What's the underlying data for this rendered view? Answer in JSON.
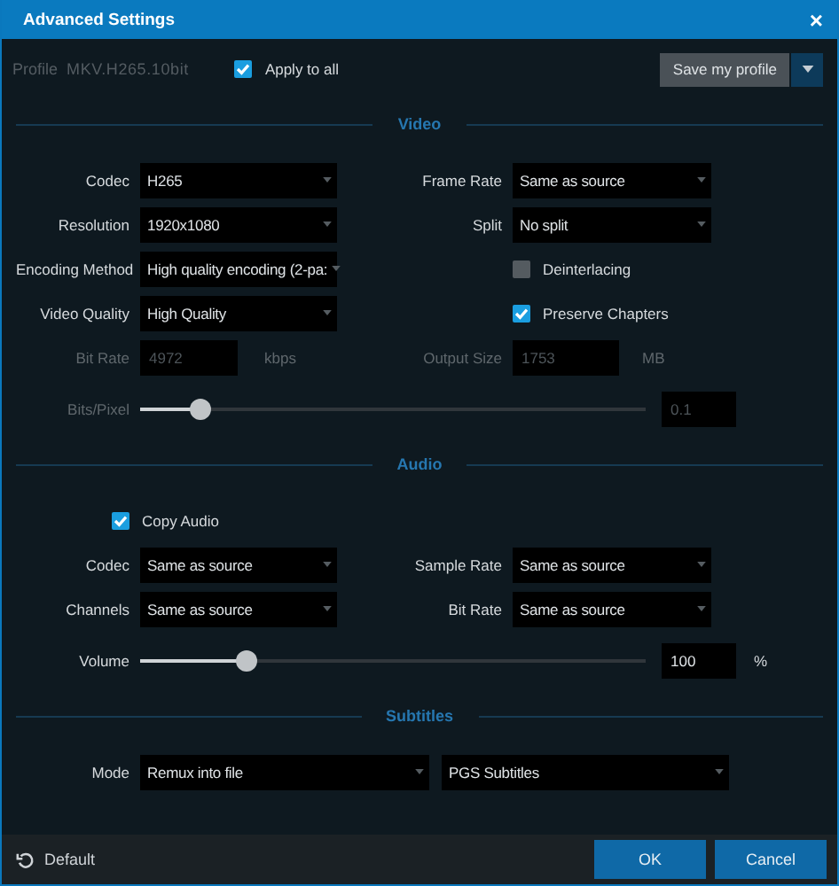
{
  "window": {
    "title": "Advanced Settings",
    "close": "×"
  },
  "profile": {
    "label": "Profile",
    "value": "MKV.H265.10bit"
  },
  "apply_to_all": {
    "label": "Apply to all",
    "checked": true
  },
  "save_profile": {
    "label": "Save my profile"
  },
  "sections": [
    {
      "title": "Video",
      "rows": [
        {
          "kind": "pair",
          "left": {
            "kind": "select",
            "label": "Codec",
            "value": "H265"
          },
          "right": {
            "kind": "select",
            "label": "Frame Rate",
            "value": "Same as source"
          }
        },
        {
          "kind": "pair",
          "left": {
            "kind": "select",
            "label": "Resolution",
            "value": "1920x1080"
          },
          "right": {
            "kind": "select",
            "label": "Split",
            "value": "No split"
          }
        },
        {
          "kind": "pair",
          "left": {
            "kind": "select",
            "label": "Encoding Method",
            "value": "High quality encoding (2-pa:"
          },
          "right": {
            "kind": "checkbox",
            "label": "Deinterlacing",
            "checked": false
          }
        },
        {
          "kind": "pair",
          "left": {
            "kind": "select",
            "label": "Video Quality",
            "value": "High Quality"
          },
          "right": {
            "kind": "checkbox",
            "label": "Preserve Chapters",
            "checked": true
          }
        },
        {
          "kind": "pair",
          "left": {
            "kind": "input",
            "label": "Bit Rate",
            "value": "4972",
            "unit": "kbps",
            "disabled": true
          },
          "right": {
            "kind": "input",
            "label": "Output Size",
            "value": "1753",
            "unit": "MB",
            "disabled": true
          }
        },
        {
          "kind": "slider",
          "label": "Bits/Pixel",
          "level": 0.12,
          "value": "0.1",
          "disabled": true
        }
      ]
    },
    {
      "title": "Audio",
      "rows": [
        {
          "kind": "pair",
          "left": {
            "kind": "checkbox",
            "label": "Copy Audio",
            "checked": true
          }
        },
        {
          "kind": "pair",
          "left": {
            "kind": "select",
            "label": "Codec",
            "value": "Same as source"
          },
          "right": {
            "kind": "select",
            "label": "Sample Rate",
            "value": "Same as source"
          }
        },
        {
          "kind": "pair",
          "left": {
            "kind": "select",
            "label": "Channels",
            "value": "Same as source"
          },
          "right": {
            "kind": "select",
            "label": "Bit Rate",
            "value": "Same as source"
          }
        },
        {
          "kind": "slider",
          "label": "Volume",
          "level": 0.21,
          "value": "100",
          "unit": "%",
          "disabled": false
        }
      ]
    },
    {
      "title": "Subtitles",
      "rows": [
        {
          "kind": "wide",
          "label": "Mode",
          "values": [
            "Remux into file",
            "PGS Subtitles"
          ]
        }
      ]
    }
  ],
  "footer": {
    "default": "Default",
    "buttons": [
      "OK",
      "Cancel"
    ]
  }
}
